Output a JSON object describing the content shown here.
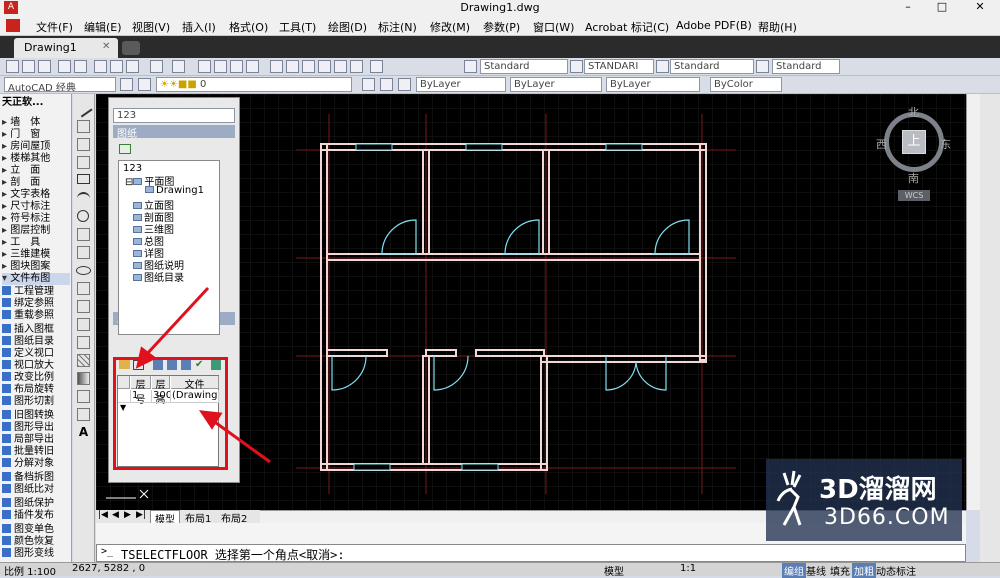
{
  "window": {
    "title": "Drawing1.dwg"
  },
  "menu": [
    "文件(F)",
    "编辑(E)",
    "视图(V)",
    "插入(I)",
    "格式(O)",
    "工具(T)",
    "绘图(D)",
    "标注(N)",
    "修改(M)",
    "参数(P)",
    "窗口(W)",
    "Acrobat 标记(C)",
    "Adobe PDF(B)",
    "帮助(H)"
  ],
  "document_tab": {
    "label": "Drawing1"
  },
  "toolbar": {
    "text_style": "Standard",
    "dim_style": "STANDARI",
    "table_style": "Standard",
    "multileader_style": "Standard",
    "workspace": "AutoCAD 经典",
    "current_layer": "0",
    "color": "ByLayer",
    "linetype": "ByLayer",
    "lineweight": "ByLayer",
    "plotstyle": "ByColor"
  },
  "left_menu": {
    "header": "天正软...",
    "items": [
      "墙　体",
      "门　窗",
      "房间屋顶",
      "楼梯其他",
      "立　面",
      "剖　面",
      "文字表格",
      "尺寸标注",
      "符号标注",
      "图层控制",
      "工　具",
      "三维建模",
      "图块图案",
      "文件布图"
    ],
    "sub_items": [
      "工程管理",
      "绑定参照",
      "重载参照",
      "插入图框",
      "图纸目录",
      "定义视口",
      "视口放大",
      "改变比例",
      "布局旋转",
      "图形切割",
      "旧图转换",
      "图形导出",
      "局部导出",
      "批量转旧",
      "分解对象",
      "备档拆图",
      "图纸比对",
      "图纸保护",
      "插件发布",
      "图变单色",
      "颜色恢复",
      "图形变线"
    ]
  },
  "project_panel": {
    "project_name": "123",
    "section_drawings": "图纸",
    "section_floors": "楼层",
    "side_title": "工程管理",
    "tree": {
      "root": "123",
      "plan": "平面图",
      "plan_child": "Drawing1",
      "nodes": [
        "立面图",
        "剖面图",
        "三维图",
        "总图",
        "详图",
        "图纸说明",
        "图纸目录"
      ]
    },
    "floor_table": {
      "headers": [
        "层号",
        "层高",
        "文件"
      ],
      "row": [
        "1",
        "3000",
        "(Drawing1<"
      ]
    }
  },
  "viewcube": {
    "north": "北",
    "south": "南",
    "east": "东",
    "west": "西",
    "top": "上",
    "wcs": "WCS"
  },
  "layout_tabs": [
    "模型",
    "布局1",
    "布局2"
  ],
  "command": {
    "text": "TSELECTFLOOR 选择第一个角点<取消>:"
  },
  "status": {
    "scale": "比例 1:100",
    "coords": "2627,  5282 ,  0",
    "model": "模型",
    "anno_scale": "1:1",
    "items": [
      "编组",
      "基线",
      "填充",
      "加粗",
      "动态标注"
    ]
  },
  "watermark": {
    "main": "3D溜溜网",
    "sub": "3D66.COM"
  },
  "colors": {
    "wall": "#f2d7d7",
    "window": "#7fe0f0",
    "door": "#7fe0f0",
    "grid": "#1c1c1c",
    "axis": "#7a1a1a",
    "annotation": "#e0101d"
  }
}
